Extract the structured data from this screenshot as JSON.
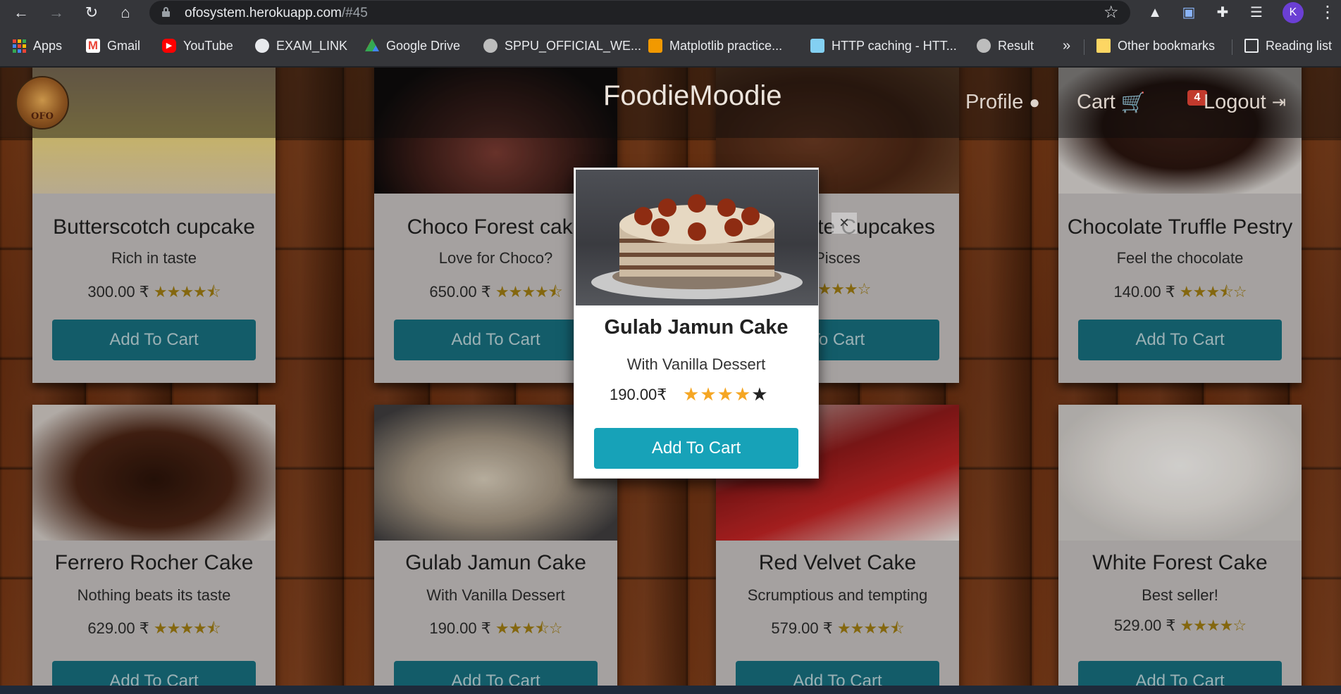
{
  "browser": {
    "url_host": "ofosystem.herokuapp.com",
    "url_path": "/#45",
    "avatar_letter": "K"
  },
  "bookmarks": {
    "items": [
      "Apps",
      "Gmail",
      "YouTube",
      "EXAM_LINK",
      "Google Drive",
      "SPPU_OFFICIAL_WE...",
      "Matplotlib practice...",
      "HTTP caching - HTT...",
      "Result"
    ],
    "overflow": "»",
    "other": "Other bookmarks",
    "reading_list": "Reading list"
  },
  "navbar": {
    "brand": "FoodieMoodie",
    "profile": "Profile",
    "cart": "Cart",
    "cart_count": "4",
    "logout": "Logout"
  },
  "products": [
    {
      "title": "Butterscotch cupcake",
      "desc": "Rich in taste",
      "price": "300.00 ₹",
      "stars": "★★★★⯪",
      "button": "Add To Cart",
      "image": "cupcakes"
    },
    {
      "title": "Choco Forest cake",
      "desc": "Love for Choco?",
      "price": "650.00 ₹",
      "stars": "★★★★⯪",
      "button": "Add To Cart",
      "image": "choco-cake"
    },
    {
      "title": "Chocolate Cupcakes",
      "desc": "Pisces",
      "price": "",
      "stars": "★★★★☆",
      "button": "To Cart",
      "image": "chocolate-cupcakes"
    },
    {
      "title": "Chocolate Truffle Pestry",
      "desc": "Feel the chocolate",
      "price": "140.00 ₹",
      "stars": "★★★⯪☆",
      "button": "Add To Cart",
      "image": "truffle-pastry"
    },
    {
      "title": "Ferrero Rocher Cake",
      "desc": "Nothing beats its taste",
      "price": "629.00 ₹",
      "stars": "★★★★⯪",
      "button": "Add To Cart",
      "image": "ferrero-cake"
    },
    {
      "title": "Gulab Jamun Cake",
      "desc": "With Vanilla Dessert",
      "price": "190.00 ₹",
      "stars": "★★★⯪☆",
      "button": "Add To Cart",
      "image": "gulab-jamun-cake"
    },
    {
      "title": "Red Velvet Cake",
      "desc": "Scrumptious and tempting",
      "price": "579.00 ₹",
      "stars": "★★★★⯪",
      "button": "Add To Cart",
      "image": "red-velvet-cake"
    },
    {
      "title": "White Forest Cake",
      "desc": "Best seller!",
      "price": "529.00 ₹",
      "stars": "★★★★☆",
      "button": "Add To Cart",
      "image": "white-forest-cake"
    }
  ],
  "modal": {
    "title": "Gulab Jamun Cake",
    "desc": "With Vanilla Dessert",
    "price": "190.00₹",
    "rating": 4,
    "rating_max": 5,
    "button": "Add To Cart",
    "close": "×"
  },
  "colors": {
    "accent": "#17a2b8",
    "star_filled": "#f5a623",
    "star_empty": "#222222",
    "badge": "#c23a2d"
  }
}
